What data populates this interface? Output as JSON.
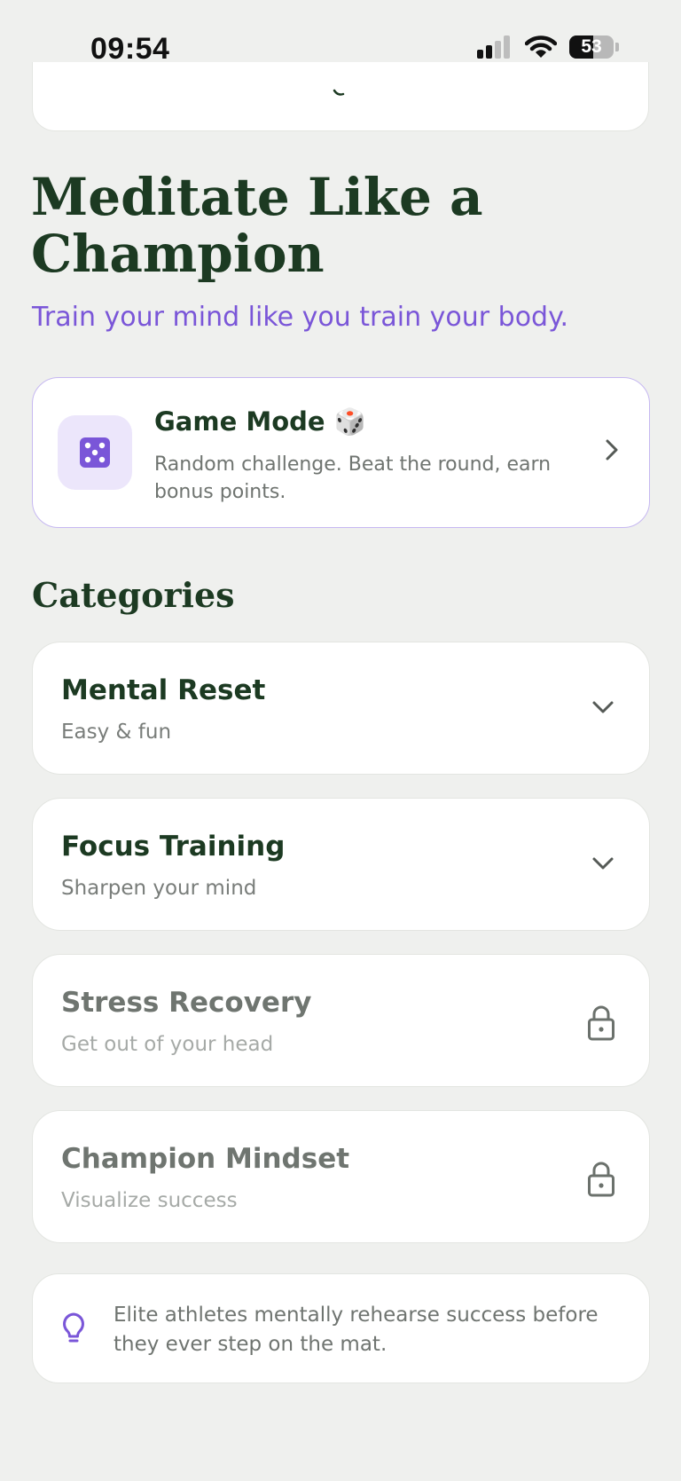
{
  "status_bar": {
    "time": "09:54",
    "battery": "53"
  },
  "header": {
    "title": "Meditate Like a Champion",
    "subtitle": "Train your mind like you train your body."
  },
  "game_mode": {
    "title": "Game Mode 🎲",
    "description": "Random challenge. Beat the round, earn bonus points."
  },
  "categories": {
    "heading": "Categories",
    "items": [
      {
        "title": "Mental Reset",
        "subtitle": "Easy & fun",
        "state": "expandable"
      },
      {
        "title": "Focus Training",
        "subtitle": "Sharpen your mind",
        "state": "expandable"
      },
      {
        "title": "Stress Recovery",
        "subtitle": "Get out of your head",
        "state": "locked"
      },
      {
        "title": "Champion Mindset",
        "subtitle": "Visualize success",
        "state": "locked"
      }
    ]
  },
  "tip": {
    "text": "Elite athletes mentally rehearse success before they ever step on the mat."
  },
  "colors": {
    "accent": "#7a56d8",
    "heading": "#1c3a22",
    "background": "#eff0ee"
  }
}
